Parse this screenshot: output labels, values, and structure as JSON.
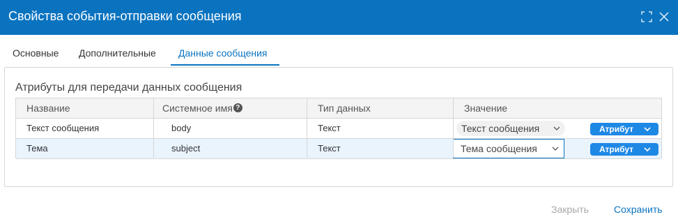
{
  "dialog": {
    "title": "Свойства события-отправки сообщения",
    "accent_color": "#0a73c0"
  },
  "tabs": [
    {
      "label": "Основные",
      "active": false
    },
    {
      "label": "Дополнительные",
      "active": false
    },
    {
      "label": "Данные сообщения",
      "active": true
    }
  ],
  "section": {
    "title": "Атрибуты для передачи данных сообщения"
  },
  "table": {
    "headers": [
      "Название",
      "Системное имя",
      "Тип данных",
      "Значение"
    ],
    "help_icon": "?",
    "rows": [
      {
        "name": "Текст сообщения",
        "system_name": "body",
        "data_type": "Текст",
        "value": "Текст сообщения",
        "value_button": "Атрибут"
      },
      {
        "name": "Тема",
        "system_name": "subject",
        "data_type": "Текст",
        "value": "Тема сообщения",
        "value_button": "Атрибут"
      }
    ]
  },
  "footer": {
    "close_label": "Закрыть",
    "save_label": "Сохранить"
  },
  "icons": {
    "maximize": "maximize-icon",
    "close": "close-icon",
    "help": "help-icon",
    "dropdown": "chevron-down-icon"
  }
}
